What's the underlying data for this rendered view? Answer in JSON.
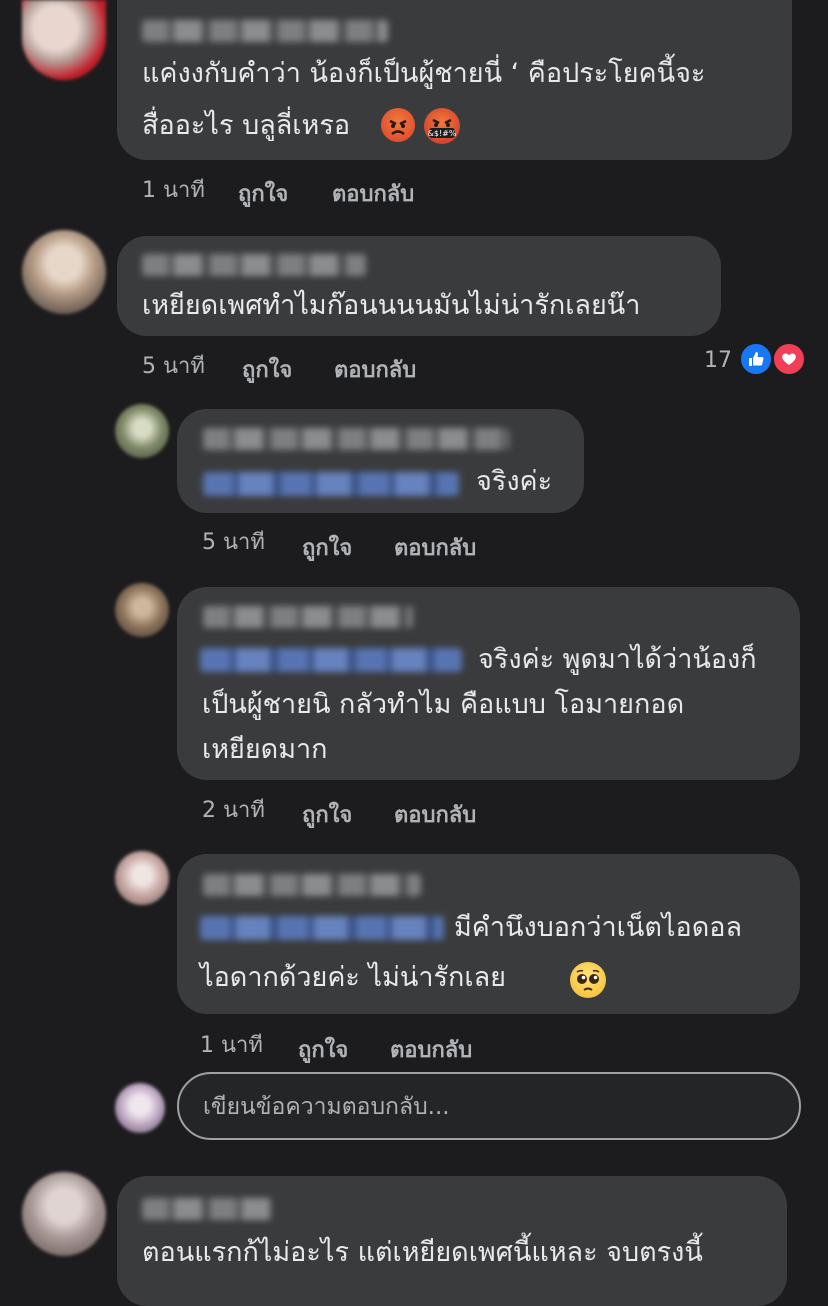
{
  "comments": [
    {
      "text_lines": [
        "แค่งงกับคำว่า น้องก็เป็นผู้ชายนี่ ‘ คือประโยคนี้จะ",
        "สื่ออะไร บลูลี่เหรอ"
      ],
      "time": "1 นาที",
      "like_label": "ถูกใจ",
      "reply_label": "ตอบกลับ"
    },
    {
      "text_lines": [
        "เหยียดเพศทำไมก๊อนนนนมันไม่น่ารักเลยน๊า"
      ],
      "time": "5 นาที",
      "like_label": "ถูกใจ",
      "reply_label": "ตอบกลับ",
      "reaction_count": "17"
    },
    {
      "text_lines": [
        "จริงค่ะ"
      ],
      "time": "5 นาที",
      "like_label": "ถูกใจ",
      "reply_label": "ตอบกลับ"
    },
    {
      "text_lines": [
        "จริงค่ะ พูดมาได้ว่าน้องก็",
        "เป็นผู้ชายนิ กลัวทำไม คือแบบ โอมายกอด",
        "เหยียดมาก"
      ],
      "time": "2 นาที",
      "like_label": "ถูกใจ",
      "reply_label": "ตอบกลับ"
    },
    {
      "text_lines": [
        "มีคำนึงบอกว่าเน็ตไอดอล",
        "ไอดากด้วยค่ะ ไม่น่ารักเลย"
      ],
      "time": "1 นาที",
      "like_label": "ถูกใจ",
      "reply_label": "ตอบกลับ"
    },
    {
      "text_lines": [
        "ตอนแรกก้ไม่อะไร แต่เหยียดเพศนี้แหละ จบตรงนี้"
      ]
    }
  ],
  "reply_input": {
    "placeholder": "เขียนข้อความตอบกลับ..."
  },
  "colors": {
    "background": "#1c1c1e",
    "bubble": "#3a3b3c",
    "meta_text": "#b0b3b8",
    "mention_blue": "#5d7fc7",
    "like_blue": "#1877f2",
    "love_red": "#f33e58"
  },
  "icons": {
    "angry": "angry-face-emoji",
    "cursing": "cursing-face-emoji",
    "pleading": "pleading-face-emoji",
    "like": "thumbs-up-icon",
    "love": "heart-icon"
  }
}
